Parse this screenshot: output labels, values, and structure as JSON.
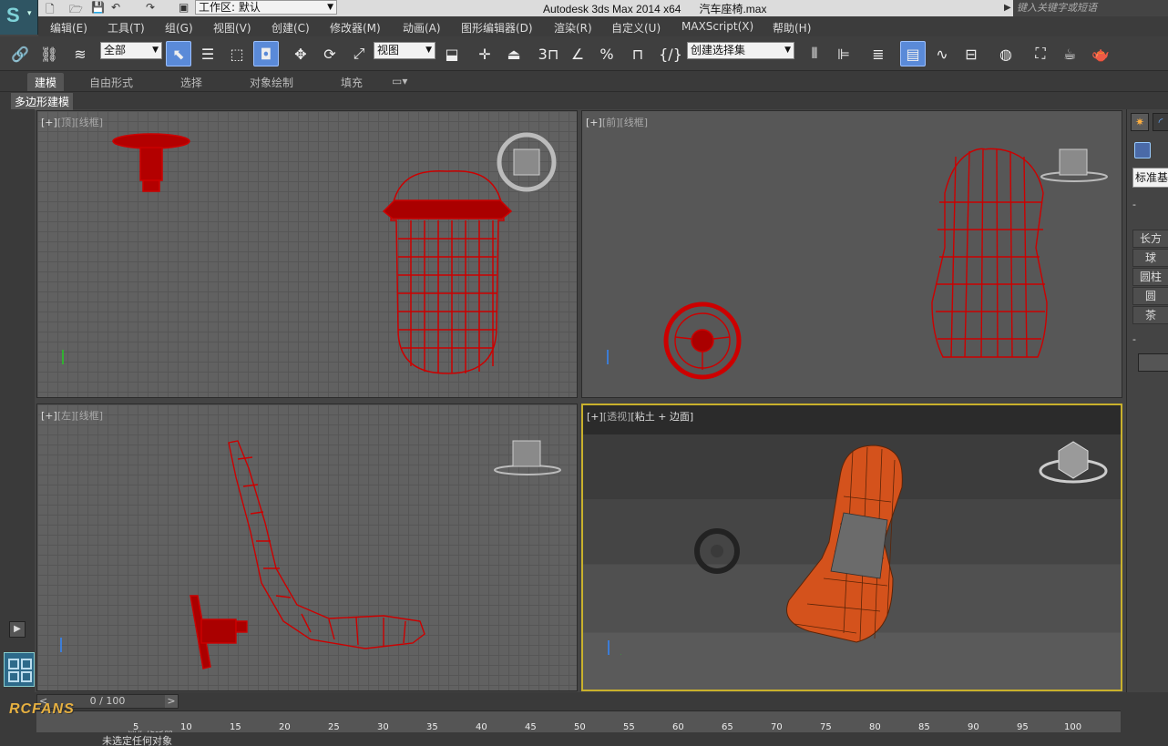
{
  "titlebar": {
    "workspace_label": "工作区: 默认",
    "app_name": "Autodesk 3ds Max  2014 x64",
    "file_name": "汽车座椅.max",
    "search_placeholder": "键入关键字或短语"
  },
  "menu": [
    "编辑(E)",
    "工具(T)",
    "组(G)",
    "视图(V)",
    "创建(C)",
    "修改器(M)",
    "动画(A)",
    "图形编辑器(D)",
    "渲染(R)",
    "自定义(U)",
    "MAXScript(X)",
    "帮助(H)"
  ],
  "toolbar": {
    "selection_filter": "全部",
    "reference_coord": "视图",
    "named_selection": "创建选择集",
    "snap_label": "3"
  },
  "ribbon": {
    "tabs": [
      "建模",
      "自由形式",
      "选择",
      "对象绘制",
      "填充"
    ],
    "subtab": "多边形建模"
  },
  "viewports": {
    "top": {
      "plus": "[+]",
      "view": "[顶]",
      "mode": "[线框]"
    },
    "front": {
      "plus": "[+]",
      "view": "[前]",
      "mode": "[线框]"
    },
    "left": {
      "plus": "[+]",
      "view": "[左]",
      "mode": "[线框]"
    },
    "perspective": {
      "plus": "[+]",
      "view": "[透视]",
      "mode": "[粘土 + 边面]"
    }
  },
  "command_panel": {
    "category": "标准基",
    "section1_label": "-",
    "section2_label": "-",
    "items": [
      "长方",
      "球",
      "圆柱",
      "圆",
      "茶"
    ]
  },
  "timeline": {
    "frame_display": "0 / 100",
    "ticks": [
      "5",
      "10",
      "15",
      "20",
      "25",
      "30",
      "35",
      "40",
      "45",
      "50",
      "55",
      "60",
      "65",
      "70",
      "75",
      "80",
      "85",
      "90",
      "95",
      "100"
    ]
  },
  "status": {
    "watermark": "RCFANS",
    "sub": "迷你侦听器",
    "message": "未选定任何对象"
  },
  "colors": {
    "wire": "#cc0000",
    "clay": "#d4521c",
    "active_border": "#c9b12c"
  }
}
